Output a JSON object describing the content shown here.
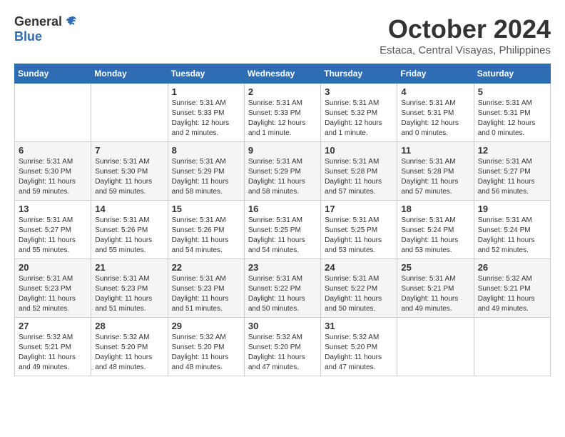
{
  "header": {
    "logo_general": "General",
    "logo_blue": "Blue",
    "month_title": "October 2024",
    "subtitle": "Estaca, Central Visayas, Philippines"
  },
  "calendar": {
    "days_of_week": [
      "Sunday",
      "Monday",
      "Tuesday",
      "Wednesday",
      "Thursday",
      "Friday",
      "Saturday"
    ],
    "weeks": [
      [
        {
          "day": "",
          "info": ""
        },
        {
          "day": "",
          "info": ""
        },
        {
          "day": "1",
          "info": "Sunrise: 5:31 AM\nSunset: 5:33 PM\nDaylight: 12 hours and 2 minutes."
        },
        {
          "day": "2",
          "info": "Sunrise: 5:31 AM\nSunset: 5:33 PM\nDaylight: 12 hours and 1 minute."
        },
        {
          "day": "3",
          "info": "Sunrise: 5:31 AM\nSunset: 5:32 PM\nDaylight: 12 hours and 1 minute."
        },
        {
          "day": "4",
          "info": "Sunrise: 5:31 AM\nSunset: 5:31 PM\nDaylight: 12 hours and 0 minutes."
        },
        {
          "day": "5",
          "info": "Sunrise: 5:31 AM\nSunset: 5:31 PM\nDaylight: 12 hours and 0 minutes."
        }
      ],
      [
        {
          "day": "6",
          "info": "Sunrise: 5:31 AM\nSunset: 5:30 PM\nDaylight: 11 hours and 59 minutes."
        },
        {
          "day": "7",
          "info": "Sunrise: 5:31 AM\nSunset: 5:30 PM\nDaylight: 11 hours and 59 minutes."
        },
        {
          "day": "8",
          "info": "Sunrise: 5:31 AM\nSunset: 5:29 PM\nDaylight: 11 hours and 58 minutes."
        },
        {
          "day": "9",
          "info": "Sunrise: 5:31 AM\nSunset: 5:29 PM\nDaylight: 11 hours and 58 minutes."
        },
        {
          "day": "10",
          "info": "Sunrise: 5:31 AM\nSunset: 5:28 PM\nDaylight: 11 hours and 57 minutes."
        },
        {
          "day": "11",
          "info": "Sunrise: 5:31 AM\nSunset: 5:28 PM\nDaylight: 11 hours and 57 minutes."
        },
        {
          "day": "12",
          "info": "Sunrise: 5:31 AM\nSunset: 5:27 PM\nDaylight: 11 hours and 56 minutes."
        }
      ],
      [
        {
          "day": "13",
          "info": "Sunrise: 5:31 AM\nSunset: 5:27 PM\nDaylight: 11 hours and 55 minutes."
        },
        {
          "day": "14",
          "info": "Sunrise: 5:31 AM\nSunset: 5:26 PM\nDaylight: 11 hours and 55 minutes."
        },
        {
          "day": "15",
          "info": "Sunrise: 5:31 AM\nSunset: 5:26 PM\nDaylight: 11 hours and 54 minutes."
        },
        {
          "day": "16",
          "info": "Sunrise: 5:31 AM\nSunset: 5:25 PM\nDaylight: 11 hours and 54 minutes."
        },
        {
          "day": "17",
          "info": "Sunrise: 5:31 AM\nSunset: 5:25 PM\nDaylight: 11 hours and 53 minutes."
        },
        {
          "day": "18",
          "info": "Sunrise: 5:31 AM\nSunset: 5:24 PM\nDaylight: 11 hours and 53 minutes."
        },
        {
          "day": "19",
          "info": "Sunrise: 5:31 AM\nSunset: 5:24 PM\nDaylight: 11 hours and 52 minutes."
        }
      ],
      [
        {
          "day": "20",
          "info": "Sunrise: 5:31 AM\nSunset: 5:23 PM\nDaylight: 11 hours and 52 minutes."
        },
        {
          "day": "21",
          "info": "Sunrise: 5:31 AM\nSunset: 5:23 PM\nDaylight: 11 hours and 51 minutes."
        },
        {
          "day": "22",
          "info": "Sunrise: 5:31 AM\nSunset: 5:23 PM\nDaylight: 11 hours and 51 minutes."
        },
        {
          "day": "23",
          "info": "Sunrise: 5:31 AM\nSunset: 5:22 PM\nDaylight: 11 hours and 50 minutes."
        },
        {
          "day": "24",
          "info": "Sunrise: 5:31 AM\nSunset: 5:22 PM\nDaylight: 11 hours and 50 minutes."
        },
        {
          "day": "25",
          "info": "Sunrise: 5:31 AM\nSunset: 5:21 PM\nDaylight: 11 hours and 49 minutes."
        },
        {
          "day": "26",
          "info": "Sunrise: 5:32 AM\nSunset: 5:21 PM\nDaylight: 11 hours and 49 minutes."
        }
      ],
      [
        {
          "day": "27",
          "info": "Sunrise: 5:32 AM\nSunset: 5:21 PM\nDaylight: 11 hours and 49 minutes."
        },
        {
          "day": "28",
          "info": "Sunrise: 5:32 AM\nSunset: 5:20 PM\nDaylight: 11 hours and 48 minutes."
        },
        {
          "day": "29",
          "info": "Sunrise: 5:32 AM\nSunset: 5:20 PM\nDaylight: 11 hours and 48 minutes."
        },
        {
          "day": "30",
          "info": "Sunrise: 5:32 AM\nSunset: 5:20 PM\nDaylight: 11 hours and 47 minutes."
        },
        {
          "day": "31",
          "info": "Sunrise: 5:32 AM\nSunset: 5:20 PM\nDaylight: 11 hours and 47 minutes."
        },
        {
          "day": "",
          "info": ""
        },
        {
          "day": "",
          "info": ""
        }
      ]
    ]
  }
}
